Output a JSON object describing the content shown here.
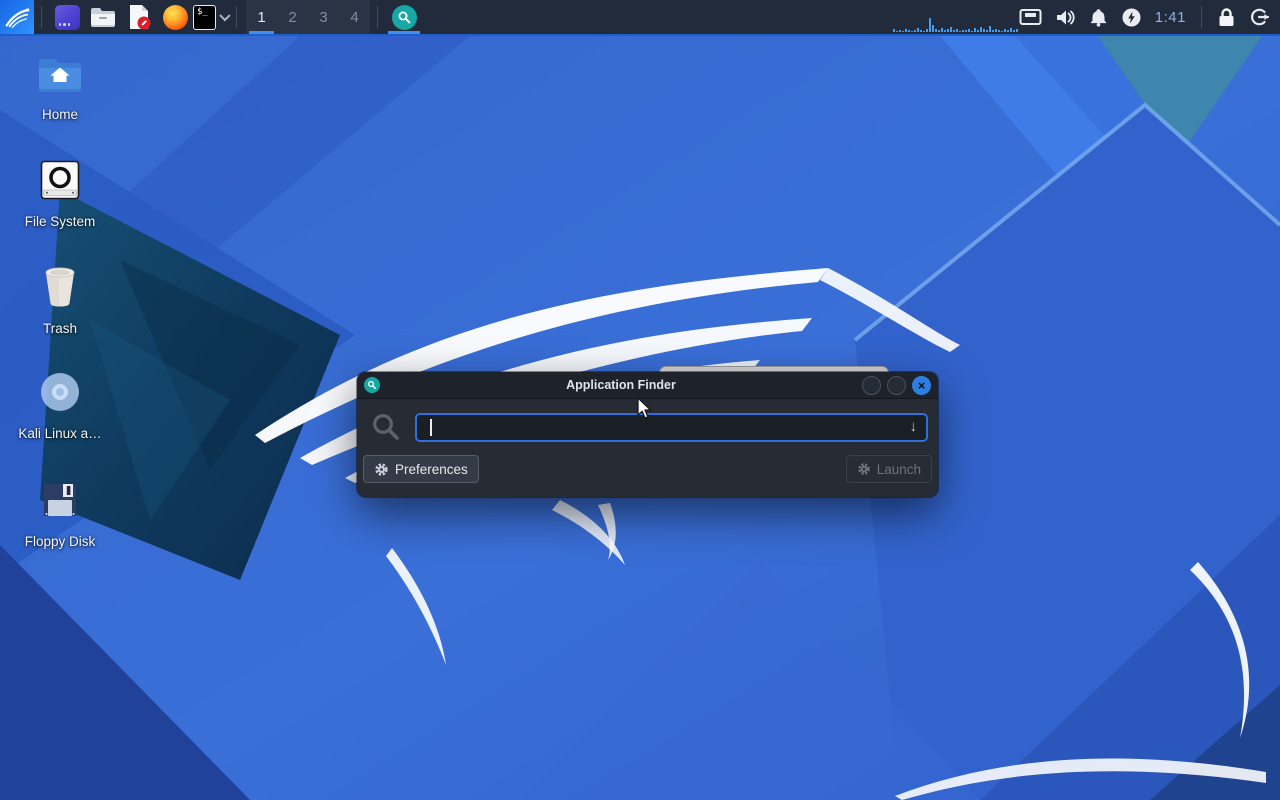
{
  "panel": {
    "workspaces": [
      {
        "label": "1",
        "active": true
      },
      {
        "label": "2",
        "active": false
      },
      {
        "label": "3",
        "active": false
      },
      {
        "label": "4",
        "active": false
      }
    ],
    "terminal_glyph": "$_",
    "clock": "1:41",
    "cpu_graph_bars": [
      3,
      1,
      2,
      1,
      3,
      2,
      1,
      2,
      4,
      2,
      1,
      3,
      14,
      7,
      3,
      2,
      4,
      2,
      3,
      5,
      2,
      3,
      1,
      2,
      2,
      3,
      1,
      4,
      2,
      5,
      3,
      2,
      6,
      2,
      3,
      2,
      1,
      3,
      2,
      4,
      2,
      3
    ],
    "icon_names": [
      "kali-menu",
      "window-app",
      "file-manager",
      "text-editor",
      "firefox",
      "terminal",
      "app-finder",
      "network",
      "volume",
      "notifications",
      "power",
      "lock",
      "logout"
    ]
  },
  "desktop": {
    "icons": [
      {
        "label": "Home",
        "icon": "home-folder-icon"
      },
      {
        "label": "File System",
        "icon": "drive-icon"
      },
      {
        "label": "Trash",
        "icon": "trash-icon"
      },
      {
        "label": "Kali Linux a…",
        "icon": "disc-icon"
      },
      {
        "label": "Floppy Disk",
        "icon": "floppy-icon"
      }
    ]
  },
  "finder_dialog": {
    "title": "Application Finder",
    "close_glyph": "×",
    "search_input": {
      "value": "",
      "placeholder": ""
    },
    "dropdown_glyph": "↓",
    "preferences_label": "Preferences",
    "launch_label": "Launch",
    "launch_enabled": false
  },
  "colors": {
    "panel_bg": "#222b3c",
    "accent_underline": "#3f8ef0",
    "dialog_bg": "#262b34",
    "titlebar_bg": "#1e222a",
    "input_border": "#2e6fe0",
    "close_button": "#2e7fe2",
    "appfinder_teal": "#17a7a4",
    "clock_text": "#8fafe4"
  }
}
